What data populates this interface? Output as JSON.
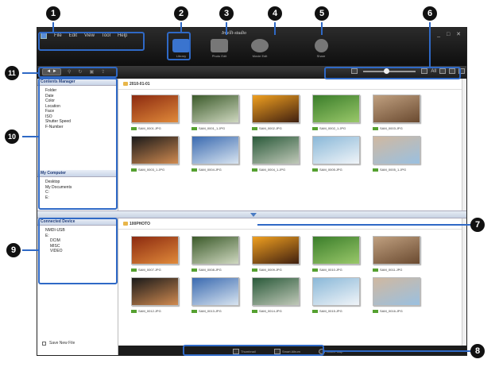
{
  "app": {
    "title": "Intelli-studio"
  },
  "menu": [
    "File",
    "Edit",
    "View",
    "Tool",
    "Help"
  ],
  "window_controls": "_ □ ✕",
  "modes": [
    {
      "label": "Library",
      "color": "#3a74cf"
    },
    {
      "label": "Photo Edit",
      "color": "#888"
    },
    {
      "label": "Movie Edit",
      "color": "#888"
    },
    {
      "label": "Share",
      "color": "#888"
    }
  ],
  "toolbar": {
    "nav": "◄ ►",
    "tools": [
      "⚲",
      "↻",
      "▣",
      "⇪"
    ],
    "view_all": "All"
  },
  "contents_manager": {
    "header": "Contents Manager",
    "items": [
      "Folder",
      "Date",
      "Color",
      "Location",
      "Face",
      "ISO",
      "Shutter Speed",
      "F-Number"
    ]
  },
  "my_computer": {
    "header": "My Computer",
    "items": [
      "Desktop",
      "My Documents",
      "C:",
      "E:"
    ]
  },
  "connected_device": {
    "header": "Connected Device",
    "items": [
      "NMDI-USB",
      "E:",
      "DCIM",
      "MISC",
      "VIDEO"
    ]
  },
  "save_new_file": "Save New File",
  "folder1": {
    "name": "2010-01-01"
  },
  "folder2": {
    "name": "100PHOTO"
  },
  "photos1": [
    {
      "name": "SAM_0001.JPG",
      "c1": "#8c2a10",
      "c2": "#e08a3a"
    },
    {
      "name": "SAM_0001_1.JPG",
      "c1": "#3b5a2a",
      "c2": "#cfd8c0"
    },
    {
      "name": "SAM_0002.JPG",
      "c1": "#f0a020",
      "c2": "#402010"
    },
    {
      "name": "SAM_0002_1.JPG",
      "c1": "#3a7d2a",
      "c2": "#9ac86a"
    },
    {
      "name": "SAM_0003.JPG",
      "c1": "#c0a080",
      "c2": "#6a4a30"
    },
    {
      "name": "SAM_0003_1.JPG",
      "c1": "#1a1a1a",
      "c2": "#d08a50"
    },
    {
      "name": "SAM_0004.JPG",
      "c1": "#3a6ab0",
      "c2": "#d8e4f0"
    },
    {
      "name": "SAM_0004_1.JPG",
      "c1": "#2a5a3a",
      "c2": "#c0c8b8"
    },
    {
      "name": "SAM_0005.JPG",
      "c1": "#8ab8d8",
      "c2": "#f0f4f8"
    },
    {
      "name": "SAM_0005_1.JPG",
      "c1": "#d0b8a0",
      "c2": "#9ac0e0"
    }
  ],
  "photos2": [
    {
      "name": "SAM_0007.JPG",
      "c1": "#8c2a10",
      "c2": "#e08a3a"
    },
    {
      "name": "SAM_0008.JPG",
      "c1": "#3b5a2a",
      "c2": "#cfd8c0"
    },
    {
      "name": "SAM_0009.JPG",
      "c1": "#f0a020",
      "c2": "#402010"
    },
    {
      "name": "SAM_0010.JPG",
      "c1": "#3a7d2a",
      "c2": "#9ac86a"
    },
    {
      "name": "SAM_0011.JPG",
      "c1": "#c0a080",
      "c2": "#6a4a30"
    },
    {
      "name": "SAM_0012.JPG",
      "c1": "#1a1a1a",
      "c2": "#d08a50"
    },
    {
      "name": "SAM_0013.JPG",
      "c1": "#3a6ab0",
      "c2": "#d8e4f0"
    },
    {
      "name": "SAM_0014.JPG",
      "c1": "#2a5a3a",
      "c2": "#c0c8b8"
    },
    {
      "name": "SAM_0015.JPG",
      "c1": "#8ab8d8",
      "c2": "#f0f4f8"
    },
    {
      "name": "SAM_0016.JPG",
      "c1": "#d0b8a0",
      "c2": "#9ac0e0"
    }
  ],
  "bottom_tabs": [
    "Thumbnail",
    "Smart Album",
    "Online Map"
  ],
  "callouts": [
    "1",
    "2",
    "3",
    "4",
    "5",
    "6",
    "7",
    "8",
    "9",
    "10",
    "11"
  ],
  "accent_color": "#2f69c6"
}
